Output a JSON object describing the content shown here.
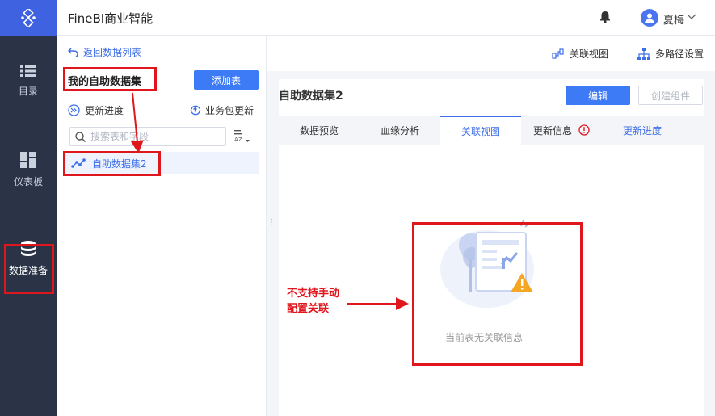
{
  "app": {
    "title": "FineBI商业智能",
    "user": "夏梅"
  },
  "nav": [
    {
      "label": "目录"
    },
    {
      "label": "仪表板"
    },
    {
      "label": "数据准备"
    }
  ],
  "left_panel": {
    "back_label": "返回数据列表",
    "section_title": "我的自助数据集",
    "add_table": "添加表",
    "update_progress": "更新进度",
    "pkg_update": "业务包更新",
    "search_placeholder": "搜索表和字段",
    "dataset_item": "自助数据集2"
  },
  "right_toolbar": {
    "relation_view": "关联视图",
    "multipath": "多路径设置"
  },
  "dataset": {
    "title": "自助数据集2",
    "edit": "编辑",
    "create_component": "创建组件",
    "tabs": [
      "数据预览",
      "血缘分析",
      "关联视图",
      "更新信息",
      "更新进度"
    ],
    "active_tab": "关联视图",
    "empty_text": "当前表无关联信息"
  },
  "annotation": {
    "line1": "不支持手动",
    "line2": "配置关联"
  },
  "colors": {
    "accent": "#3d7af5",
    "nav_bg": "#2b3447",
    "logo_bg": "#3f63e0",
    "annotation": "#e0161d"
  }
}
